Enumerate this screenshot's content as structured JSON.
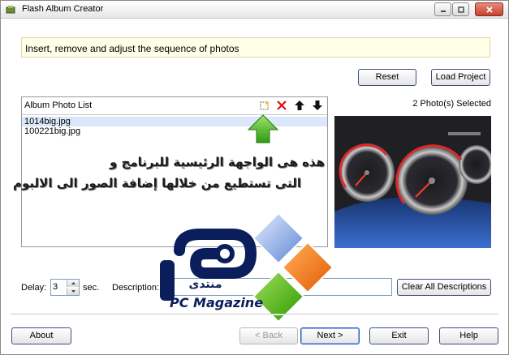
{
  "window": {
    "title": "Flash Album Creator",
    "icon": "app-icon",
    "controls": [
      "minimize-icon",
      "maximize-icon",
      "close-icon"
    ]
  },
  "instruction": "Insert, remove and adjust the sequence of photos",
  "top_buttons": {
    "reset": "Reset",
    "load_project": "Load Project"
  },
  "photo_list": {
    "title": "Album Photo List",
    "tools": [
      "new-icon",
      "delete-icon",
      "move-up-icon",
      "move-down-icon"
    ],
    "items": [
      {
        "name": "1014big.jpg",
        "selected": true
      },
      {
        "name": "100221big.jpg",
        "selected": false
      }
    ]
  },
  "selected_count": "2 Photo(s) Selected",
  "annotation": {
    "line1": "هذه هى الواجهة الرئيسية للبرنامج و",
    "line2": "التى تستطيع من خلالها إضافة الصور الى الالبوم"
  },
  "settings": {
    "delay_label": "Delay:",
    "delay_value": "3",
    "sec_label": "sec.",
    "description_label": "Description:",
    "description_value": "",
    "clear_all_label": "Clear All Descriptions"
  },
  "watermark": {
    "arabic_word": "منتدى",
    "brand": "PC Magazine"
  },
  "bottom_buttons": {
    "about": "About",
    "back": "< Back",
    "next": "Next >",
    "exit": "Exit",
    "help": "Help"
  },
  "colors": {
    "instruction_bg": "#ffffe8",
    "selection_bg": "#dbe7fb",
    "button_border": "#3c4f7a",
    "arrow_green": "#3fae1f"
  }
}
